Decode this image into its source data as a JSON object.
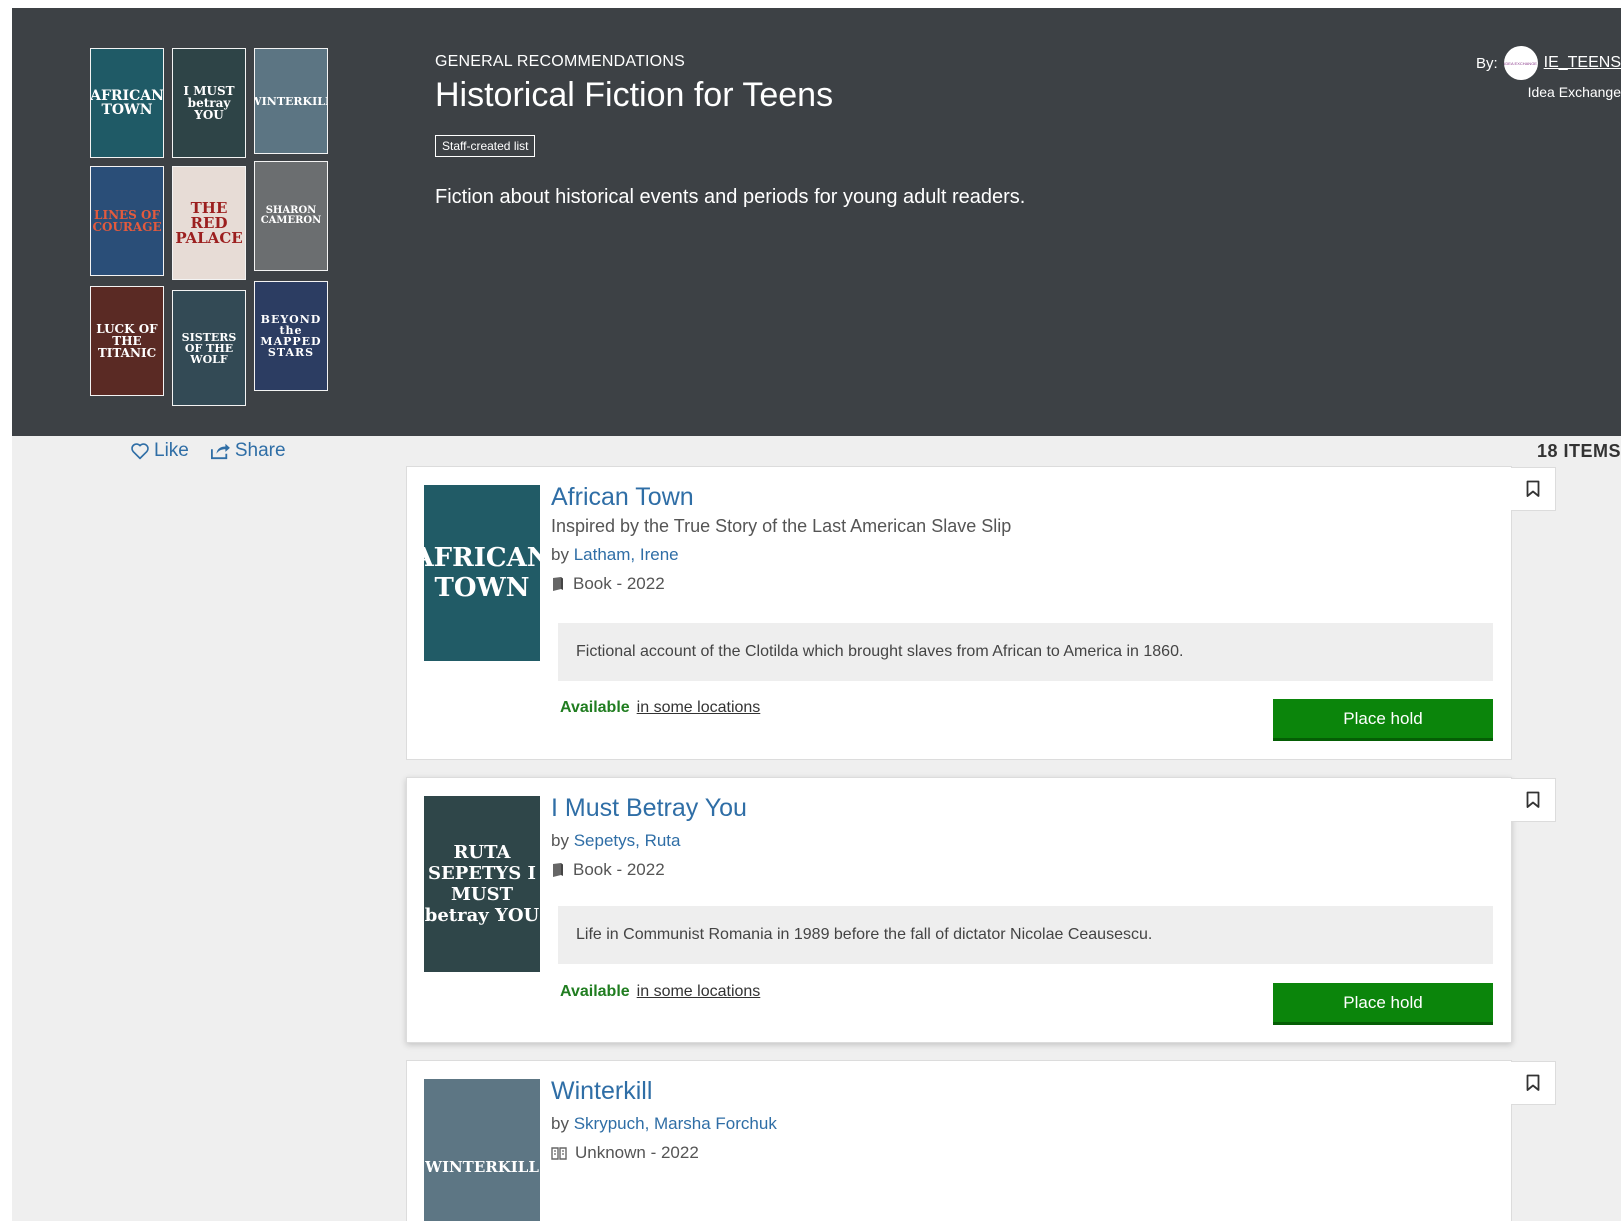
{
  "list": {
    "label": "GENERAL RECOMMENDATIONS",
    "title": "Historical Fiction for Teens",
    "badge": "Staff-created list",
    "description": "Fiction about historical events and periods for young adult readers.",
    "by_prefix": "By:",
    "author_name": "IE_TEENS",
    "author_org": "Idea Exchange",
    "avatar_text": "IDEA EXCHANGE"
  },
  "cover_grid": [
    {
      "title": "AFRICAN TOWN",
      "color": "#1f5a66"
    },
    {
      "title": "I MUST betray YOU",
      "color": "#2e4447"
    },
    {
      "title": "WINTERKILL",
      "color": "#5c7583"
    },
    {
      "title": "LINES OF COURAGE",
      "color": "#2a4e78"
    },
    {
      "title": "THE RED PALACE",
      "color": "#8c2a26"
    },
    {
      "title": "SHARON CAMERON",
      "color": "#6b6e70"
    },
    {
      "title": "LUCK OF THE TITANIC",
      "color": "#5a2a24"
    },
    {
      "title": "SISTERS OF THE WOLF",
      "color": "#334a55"
    },
    {
      "title": "BEYOND the MAPPED STARS",
      "color": "#2c3d62"
    }
  ],
  "toolbar": {
    "like": "Like",
    "share": "Share",
    "items_count": "18 ITEMS"
  },
  "items": [
    {
      "title": "African Town",
      "subtitle": "Inspired by the True Story of the Last American Slave Slip",
      "by": "by",
      "author": "Latham, Irene",
      "format": "Book - 2022",
      "annotation": "Fictional account of the Clotilda which brought slaves from African to America in 1860.",
      "available": "Available",
      "locations": "in some locations",
      "hold": "Place hold",
      "cover_text": "AFRICAN TOWN",
      "cover_color": "#215b66"
    },
    {
      "title": "I Must Betray You",
      "subtitle": "",
      "by": "by",
      "author": "Sepetys, Ruta",
      "format": "Book - 2022",
      "annotation": "Life in Communist Romania in 1989 before the fall of dictator Nicolae Ceausescu.",
      "available": "Available",
      "locations": "in some locations",
      "hold": "Place hold",
      "cover_text": "RUTA SEPETYS I MUST betray YOU",
      "cover_color": "#2f4649"
    },
    {
      "title": "Winterkill",
      "subtitle": "",
      "by": "by",
      "author": "Skrypuch, Marsha Forchuk",
      "format": "Unknown - 2022",
      "annotation": "",
      "available": "",
      "locations": "",
      "hold": "",
      "cover_text": "WINTERKILL",
      "cover_color": "#5d7684"
    }
  ],
  "colors": {
    "hero_bg": "#3d4145",
    "link": "#2f6ea6",
    "available": "#207d20",
    "hold_button": "#0b850b"
  }
}
